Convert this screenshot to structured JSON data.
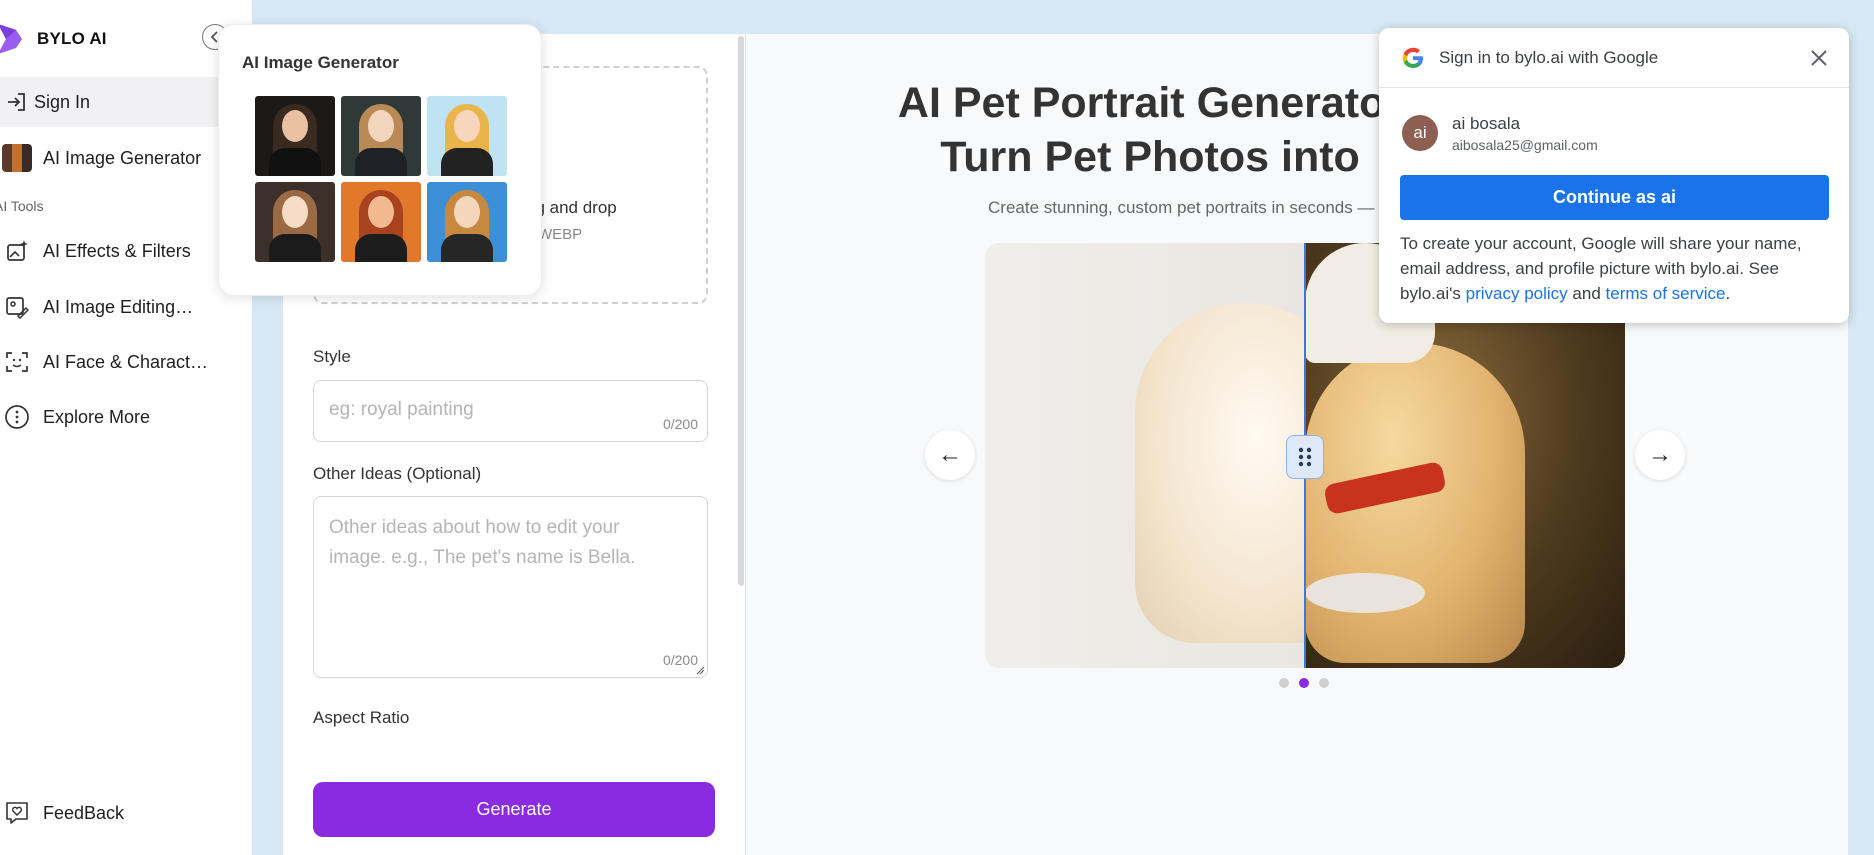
{
  "sidebar": {
    "brand": "BYLO AI",
    "sign_in": "Sign In",
    "ai_image_generator": "AI Image Generator",
    "section_label": "AI Tools",
    "items": [
      {
        "label": "AI Effects & Filters",
        "icon": "sparkle-image-icon"
      },
      {
        "label": "AI Image Editing…",
        "icon": "image-edit-icon"
      },
      {
        "label": "AI Face & Charact…",
        "icon": "face-scan-icon"
      },
      {
        "label": "Explore More",
        "icon": "more-dots-icon"
      }
    ],
    "feedback": "FeedBack"
  },
  "popover": {
    "title": "AI Image Generator",
    "thumbnails": [
      "portrait-dark-hair",
      "portrait-anime-long-hair",
      "portrait-cartoon-with-dog",
      "portrait-anime-brown-hair",
      "portrait-cartoon-red-hair",
      "portrait-chibi-blue-bg"
    ]
  },
  "form": {
    "upload_text": "ag and drop",
    "upload_formats": "WEBP",
    "style_label": "Style",
    "style_placeholder": "eg: royal painting",
    "style_count": "0/200",
    "other_label": "Other Ideas (Optional)",
    "other_placeholder": "Other ideas about how to edit your image. e.g., The pet's name is Bella.",
    "other_count": "0/200",
    "aspect_label": "Aspect Ratio",
    "generate": "Generate"
  },
  "preview": {
    "title_line1": "AI Pet Portrait Generator",
    "title_line2": "Turn Pet Photos into",
    "subtitle": "Create stunning, custom pet portraits in seconds —",
    "prev_arrow": "←",
    "next_arrow": "→",
    "slide_count": 3,
    "active_slide": 2
  },
  "google_signin": {
    "title": "Sign in to bylo.ai with Google",
    "avatar_initials": "ai",
    "account_name": "ai bosala",
    "account_email": "aibosala25@gmail.com",
    "continue": "Continue as ai",
    "disclaimer_part1": "To create your account, Google will share your name, email address, and profile picture with bylo.ai. See bylo.ai's",
    "privacy_link": "privacy policy",
    "and": "and",
    "terms_link": "terms of service",
    "period": "."
  },
  "colors": {
    "accent": "#8a2be2",
    "google_blue": "#1a73e8",
    "background": "#d6e8f3"
  }
}
